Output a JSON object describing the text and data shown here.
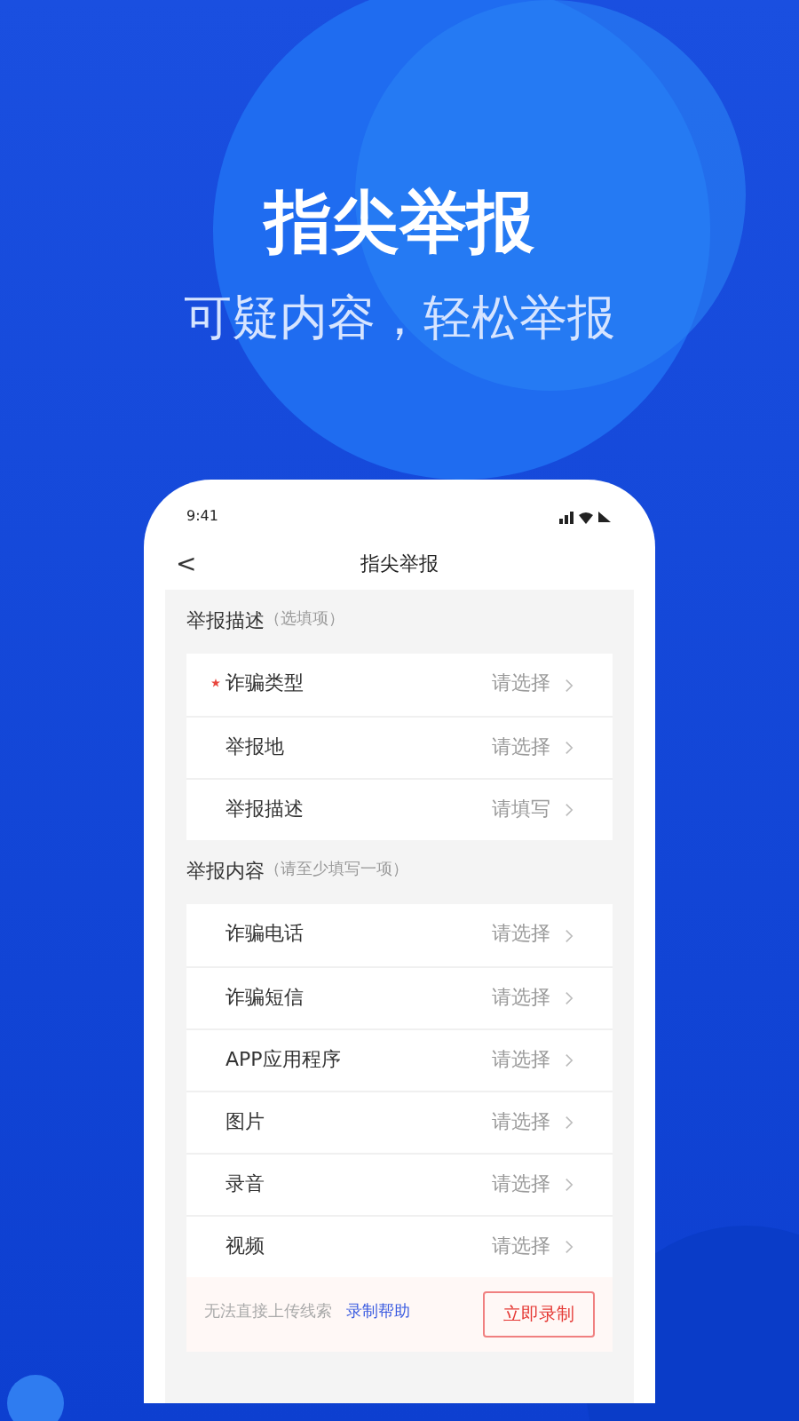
{
  "hero": {
    "title": "指尖举报",
    "subtitle": "可疑内容，轻松举报"
  },
  "phone": {
    "status_bar": {
      "time": "9:41"
    },
    "nav": {
      "back": "<",
      "title": "指尖举报"
    },
    "sections": [
      {
        "title": "举报描述",
        "hint": "（选填项）",
        "rows": [
          {
            "label": "诈骗类型",
            "value": "请选择",
            "required": true
          },
          {
            "label": "举报地",
            "value": "请选择",
            "required": false
          },
          {
            "label": "举报描述",
            "value": "请填写",
            "required": false
          }
        ]
      },
      {
        "title": "举报内容",
        "hint": "（请至少填写一项）",
        "rows": [
          {
            "label": "诈骗电话",
            "value": "请选择",
            "required": false
          },
          {
            "label": "诈骗短信",
            "value": "请选择",
            "required": false
          },
          {
            "label": "APP应用程序",
            "value": "请选择",
            "required": false
          },
          {
            "label": "图片",
            "value": "请选择",
            "required": false
          },
          {
            "label": "录音",
            "value": "请选择",
            "required": false
          },
          {
            "label": "视频",
            "value": "请选择",
            "required": false
          }
        ]
      }
    ],
    "record_bar": {
      "note": "无法直接上传线索",
      "help_link": "录制帮助",
      "button": "立即录制"
    }
  }
}
